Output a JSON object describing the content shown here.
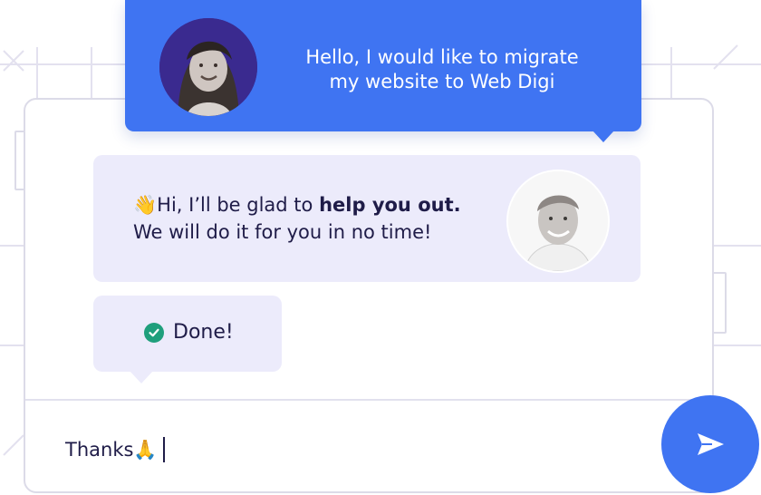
{
  "chat": {
    "user_message": {
      "avatar": "woman-avatar",
      "line1": "Hello, I would like to migrate",
      "line2": "my website to Web Digi"
    },
    "agent_message": {
      "avatar": "man-avatar",
      "wave_emoji": "👋",
      "line1_start": "Hi, I’ll be glad to ",
      "line1_bold": "help you out.",
      "line2": "We will do it for you in no time!"
    },
    "status_message": {
      "icon": "check-circle-icon",
      "label": "Done!"
    }
  },
  "composer": {
    "value": "Thanks ",
    "emoji": "🙏",
    "send_icon": "send-icon"
  },
  "colors": {
    "accent_blue": "#3f74f2",
    "bubble_lavender": "#ecebfb",
    "text_dark": "#1f1c48",
    "success_green": "#1f9f7c"
  }
}
